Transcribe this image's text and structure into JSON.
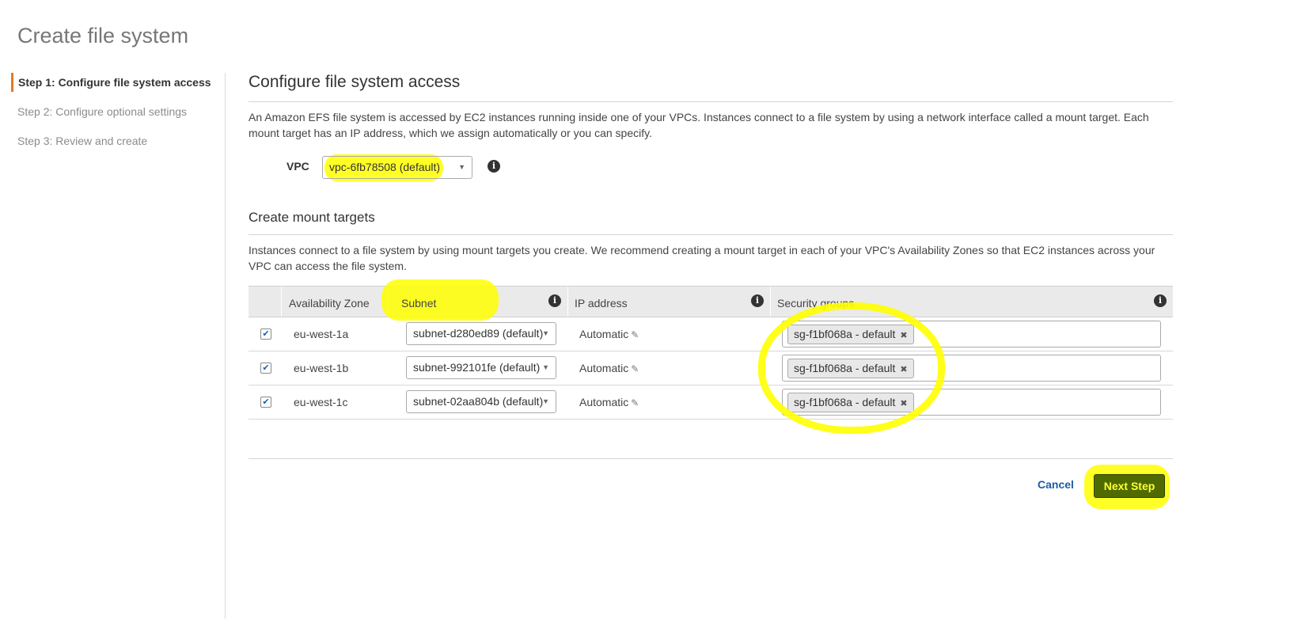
{
  "page": {
    "title": "Create file system"
  },
  "steps": [
    {
      "label": "Step 1: Configure file system access",
      "active": true
    },
    {
      "label": "Step 2: Configure optional settings",
      "active": false
    },
    {
      "label": "Step 3: Review and create",
      "active": false
    }
  ],
  "access": {
    "title": "Configure file system access",
    "description": "An Amazon EFS file system is accessed by EC2 instances running inside one of your VPCs. Instances connect to a file system by using a network interface called a mount target. Each mount target has an IP address, which we assign automatically or you can specify.",
    "vpc_label": "VPC",
    "vpc_value": "vpc-6fb78508 (default)"
  },
  "mount": {
    "title": "Create mount targets",
    "description": "Instances connect to a file system by using mount targets you create. We recommend creating a mount target in each of your VPC's Availability Zones so that EC2 instances across your VPC can access the file system.",
    "columns": {
      "az": "Availability Zone",
      "subnet": "Subnet",
      "ip": "IP address",
      "sg": "Security groups"
    },
    "rows": [
      {
        "checked": true,
        "az": "eu-west-1a",
        "subnet": "subnet-d280ed89 (default)",
        "ip": "Automatic",
        "sg": "sg-f1bf068a - default"
      },
      {
        "checked": true,
        "az": "eu-west-1b",
        "subnet": "subnet-992101fe (default)",
        "ip": "Automatic",
        "sg": "sg-f1bf068a - default"
      },
      {
        "checked": true,
        "az": "eu-west-1c",
        "subnet": "subnet-02aa804b (default)",
        "ip": "Automatic",
        "sg": "sg-f1bf068a - default"
      }
    ]
  },
  "actions": {
    "cancel": "Cancel",
    "next": "Next Step"
  },
  "icons": {
    "info": "info-icon",
    "edit": "pencil-icon",
    "remove": "close-icon",
    "check": "checkmark-icon",
    "dropdown": "caret-down-icon"
  },
  "colors": {
    "highlight": "#ffff00",
    "primary_button": "#4f6b00",
    "active_step_border": "#e07b28",
    "link": "#1b5ca8"
  }
}
